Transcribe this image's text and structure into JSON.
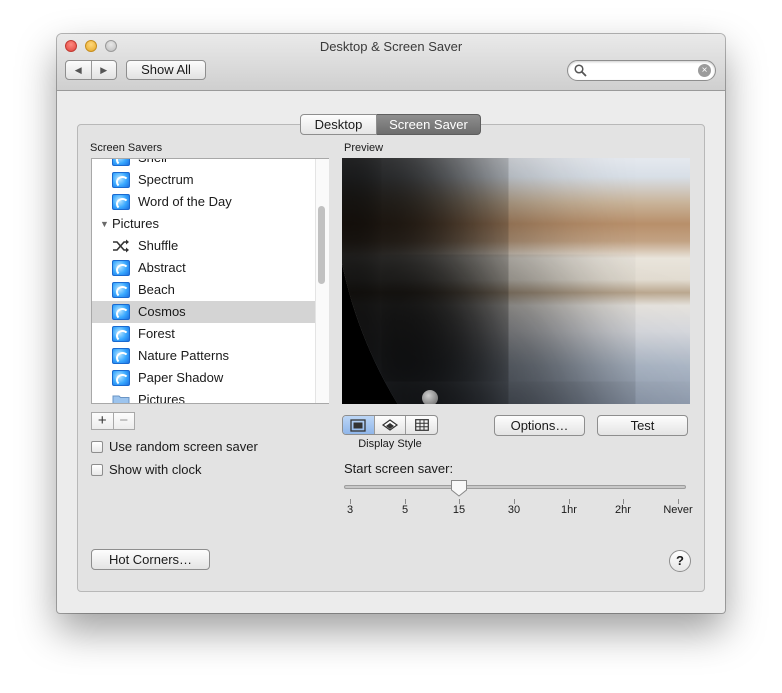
{
  "window": {
    "title": "Desktop & Screen Saver",
    "back_glyph": "◀",
    "forward_glyph": "▶",
    "show_all_label": "Show All",
    "search": {
      "value": "",
      "placeholder": ""
    }
  },
  "tabs": [
    {
      "label": "Desktop",
      "active": false
    },
    {
      "label": "Screen Saver",
      "active": true
    }
  ],
  "screen_savers": {
    "header": "Screen Savers",
    "items": [
      {
        "label": "Shell",
        "icon": "screensaver-icon",
        "selected": false
      },
      {
        "label": "Spectrum",
        "icon": "screensaver-icon",
        "selected": false
      },
      {
        "label": "Word of the Day",
        "icon": "screensaver-icon",
        "selected": false
      },
      {
        "label": "Pictures",
        "group": true,
        "expanded": true
      },
      {
        "label": "Shuffle",
        "icon": "shuffle-icon",
        "selected": false
      },
      {
        "label": "Abstract",
        "icon": "screensaver-icon",
        "selected": false
      },
      {
        "label": "Beach",
        "icon": "screensaver-icon",
        "selected": false
      },
      {
        "label": "Cosmos",
        "icon": "screensaver-icon",
        "selected": true
      },
      {
        "label": "Forest",
        "icon": "screensaver-icon",
        "selected": false
      },
      {
        "label": "Nature Patterns",
        "icon": "screensaver-icon",
        "selected": false
      },
      {
        "label": "Paper Shadow",
        "icon": "screensaver-icon",
        "selected": false
      },
      {
        "label": "Pictures",
        "icon": "folder-icon",
        "selected": false
      }
    ],
    "add_label": "+",
    "remove_label": "−"
  },
  "options": {
    "random_label": "Use random screen saver",
    "random_checked": false,
    "clock_label": "Show with clock",
    "clock_checked": false
  },
  "preview": {
    "header": "Preview",
    "display_style_label": "Display Style",
    "display_style_selected": 0,
    "options_button": "Options…",
    "test_button": "Test"
  },
  "start_saver": {
    "label": "Start screen saver:",
    "ticks": [
      "3",
      "5",
      "15",
      "30",
      "1hr",
      "2hr",
      "Never"
    ],
    "selected": "15"
  },
  "hot_corners_label": "Hot Corners…",
  "help_label": "?"
}
